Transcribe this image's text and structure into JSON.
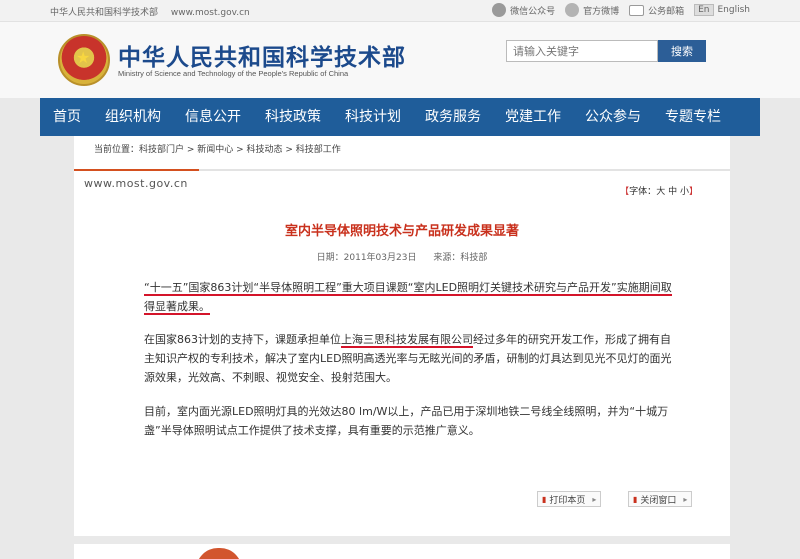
{
  "topbar": {
    "site_name": "中华人民共和国科学技术部",
    "url": "www.most.gov.cn",
    "wechat": "微信公众号",
    "weibo": "官方微博",
    "mail": "公务邮箱",
    "en_box": "En",
    "english": "English"
  },
  "header": {
    "title": "中华人民共和国科学技术部",
    "subtitle": "Ministry of Science and Technology of the People's Republic of China",
    "search_placeholder": "请输入关键字",
    "search_button": "搜索"
  },
  "nav": {
    "items": [
      "首页",
      "组织机构",
      "信息公开",
      "科技政策",
      "科技计划",
      "政务服务",
      "党建工作",
      "公众参与",
      "专题专栏"
    ]
  },
  "breadcrumb": "当前位置：科技部门户 > 新闻中心 > 科技动态 > 科技部工作",
  "domain": "www.most.gov.cn",
  "font_size": {
    "label": "字体：",
    "large": "大",
    "medium": "中",
    "small": "小"
  },
  "article": {
    "title": "室内半导体照明技术与产品研发成果显著",
    "date": "日期：2011年03月23日",
    "source": "来源：科技部",
    "p1": "“十一五”国家863计划“半导体照明工程”重大项目课题“室内LED照明灯关键技术研究与产品开发”实施期间取得显著成果。",
    "p2_before": "在国家863计划的支持下，课题承担单位",
    "p2_company": "上海三思科技发展有限公司",
    "p2_after": "经过多年的研究开发工作，形成了拥有自主知识产权的专利技术，解决了室内LED照明高透光率与无眩光间的矛盾，研制的灯具达到见光不见灯的面光源效果，光效高、不刺眼、视觉安全、投射范围大。",
    "p3": "目前，室内面光源LED照明灯具的光效达80 lm/W以上，产品已用于深圳地铁二号线全线照明，并为“十城万盏”半导体照明试点工作提供了技术支撑，具有重要的示范推广意义。"
  },
  "buttons": {
    "print": "打印本页",
    "close": "关闭窗口"
  },
  "colors": {
    "nav_bg": "#1f5d9a",
    "title_red": "#c9311d",
    "underline_red": "#d4142a",
    "brand_blue": "#1c4a8c"
  }
}
